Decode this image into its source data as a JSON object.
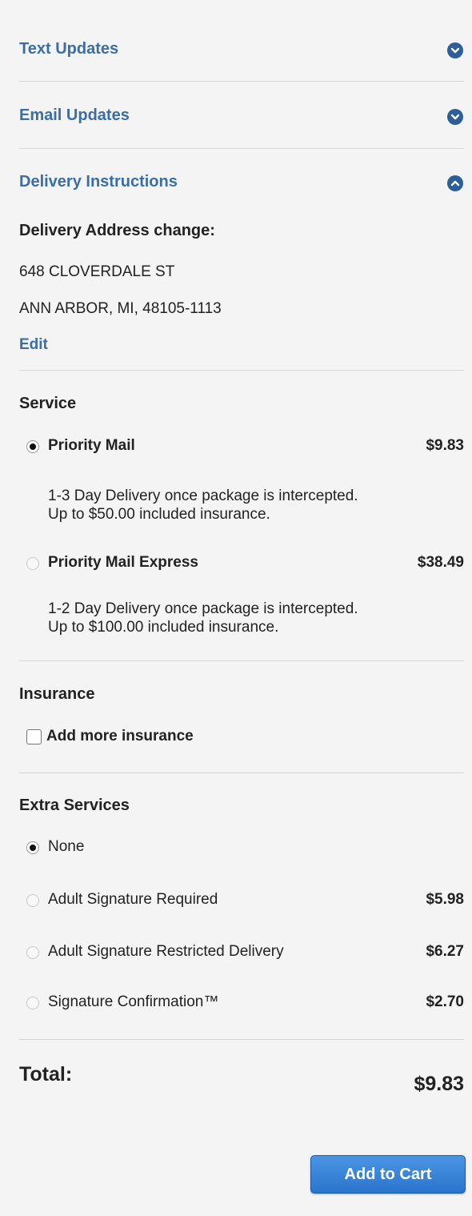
{
  "accordion": {
    "text_updates": "Text Updates",
    "email_updates": "Email Updates",
    "delivery_instructions": "Delivery Instructions"
  },
  "delivery": {
    "heading": "Delivery Address change:",
    "address_line1": "648 CLOVERDALE ST",
    "address_line2": "ANN ARBOR, MI, 48105-1113",
    "edit_label": "Edit"
  },
  "service": {
    "heading": "Service",
    "options": [
      {
        "label": "Priority Mail",
        "price": "$9.83",
        "selected": true,
        "desc1": "1-3 Day Delivery once package is intercepted.",
        "desc2": "Up to $50.00 included insurance."
      },
      {
        "label": "Priority Mail Express",
        "price": "$38.49",
        "selected": false,
        "desc1": "1-2 Day Delivery once package is intercepted.",
        "desc2": "Up to $100.00 included insurance."
      }
    ]
  },
  "insurance": {
    "heading": "Insurance",
    "checkbox_label": "Add more insurance",
    "checked": false
  },
  "extra_services": {
    "heading": "Extra Services",
    "options": [
      {
        "label": "None",
        "price": "",
        "selected": true
      },
      {
        "label": "Adult Signature Required",
        "price": "$5.98",
        "selected": false
      },
      {
        "label": "Adult Signature Restricted Delivery",
        "price": "$6.27",
        "selected": false
      },
      {
        "label": "Signature Confirmation™",
        "price": "$2.70",
        "selected": false
      }
    ]
  },
  "total": {
    "label": "Total:",
    "value": "$9.83"
  },
  "cart_button": "Add to Cart",
  "colors": {
    "link": "#3a6ea5",
    "chevron": "#2c5f99",
    "button": "#2a74cc"
  },
  "icons": {
    "chevron_down": "chevron-down-icon",
    "chevron_up": "chevron-up-icon"
  }
}
